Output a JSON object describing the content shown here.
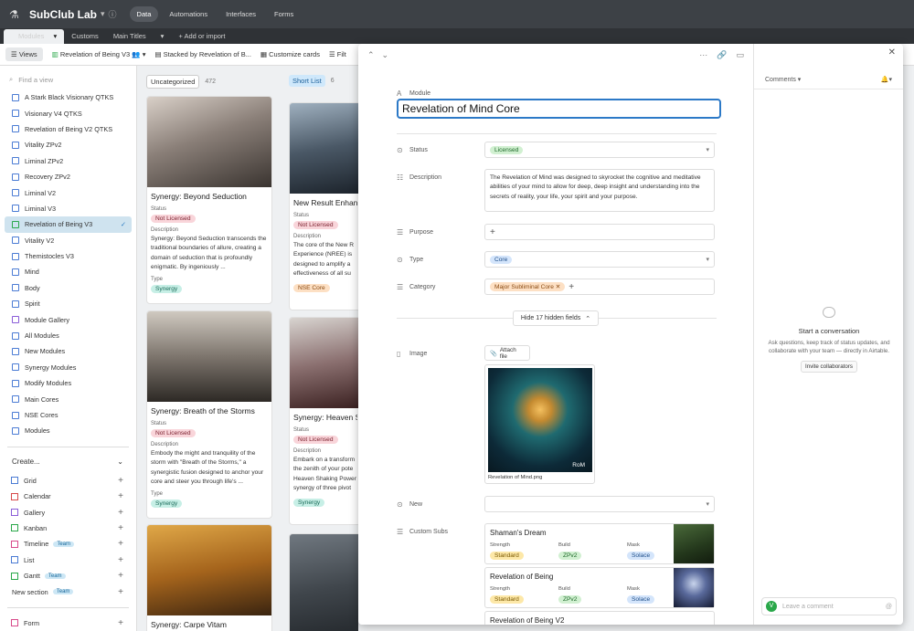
{
  "app": {
    "base_name": "SubClub Lab",
    "nav": [
      "Data",
      "Automations",
      "Interfaces",
      "Forms"
    ]
  },
  "tables": [
    "Modules",
    "Customs",
    "Main Titles",
    "+ Add or import"
  ],
  "toolbar": {
    "views": "Views",
    "current_view": "Revelation of Being V3",
    "stacked": "Stacked by Revelation of B...",
    "customize": "Customize cards",
    "filter": "Filt"
  },
  "sidebar": {
    "search_placeholder": "Find a view",
    "views": [
      {
        "label": "A Stark Black Visionary QTKS",
        "kind": "grid"
      },
      {
        "label": "Visionary V4 QTKS",
        "kind": "grid"
      },
      {
        "label": "Revelation of Being V2 QTKS",
        "kind": "grid"
      },
      {
        "label": "Vitality ZPv2",
        "kind": "grid"
      },
      {
        "label": "Liminal ZPv2",
        "kind": "grid"
      },
      {
        "label": "Recovery ZPv2",
        "kind": "grid"
      },
      {
        "label": "Liminal V2",
        "kind": "grid"
      },
      {
        "label": "Liminal V3",
        "kind": "grid"
      },
      {
        "label": "Revelation of Being V3",
        "kind": "kanban"
      },
      {
        "label": "Vitality V2",
        "kind": "grid"
      },
      {
        "label": "Themistocles V3",
        "kind": "grid"
      },
      {
        "label": "Mind",
        "kind": "grid"
      },
      {
        "label": "Body",
        "kind": "grid"
      },
      {
        "label": "Spirit",
        "kind": "grid"
      },
      {
        "label": "Module Gallery",
        "kind": "gallery"
      },
      {
        "label": "All Modules",
        "kind": "grid"
      },
      {
        "label": "New Modules",
        "kind": "grid"
      },
      {
        "label": "Synergy Modules",
        "kind": "grid"
      },
      {
        "label": "Modify Modules",
        "kind": "grid"
      },
      {
        "label": "Main Cores",
        "kind": "grid"
      },
      {
        "label": "NSE Cores",
        "kind": "grid"
      },
      {
        "label": "Modules",
        "kind": "grid"
      }
    ],
    "create_label": "Create...",
    "create_items": [
      {
        "label": "Grid",
        "badge": ""
      },
      {
        "label": "Calendar",
        "badge": ""
      },
      {
        "label": "Gallery",
        "badge": ""
      },
      {
        "label": "Kanban",
        "badge": ""
      },
      {
        "label": "Timeline",
        "badge": "Team"
      },
      {
        "label": "List",
        "badge": ""
      },
      {
        "label": "Gantt",
        "badge": "Team"
      }
    ],
    "new_section": "New section",
    "new_section_badge": "Team",
    "form_label": "Form"
  },
  "board": {
    "columns": [
      {
        "name": "Uncategorized",
        "count": "472"
      },
      {
        "name": "Short List",
        "count": "6"
      }
    ],
    "cards": [
      {
        "title": "Synergy: Beyond Seduction",
        "status_label": "Status",
        "status": "Not Licensed",
        "desc_label": "Description",
        "description": "Synergy: Beyond Seduction transcends the traditional boundaries of allure, creating a domain of seduction that is profoundly enigmatic. By ingeniously ...",
        "type_label": "Type",
        "type": "Synergy"
      },
      {
        "title": "Synergy: Breath of the Storms",
        "status_label": "Status",
        "status": "Not Licensed",
        "desc_label": "Description",
        "description": "Embody the might and tranquility of the storm with \"Breath of the Storms,\" a synergistic fusion designed to anchor your core and steer you through life's ...",
        "type_label": "Type",
        "type": "Synergy"
      },
      {
        "title": "Synergy: Carpe Vitam"
      },
      {
        "title": "New Result Enhanc",
        "status_label": "Status",
        "status": "Not Licensed",
        "desc_label": "Description",
        "description": "The core of the New R Experience (NREE) is designed to amplify a effectiveness of all su",
        "type_label": "Type",
        "type": "NSE Core"
      },
      {
        "title": "Synergy: Heaven S",
        "status_label": "Status",
        "status": "Not Licensed",
        "desc_label": "Description",
        "description": "Embark on a transform the zenith of your pote Heaven Shaking Power synergy of three pivot",
        "type_label": "Type",
        "type": "Synergy"
      }
    ]
  },
  "record": {
    "module_label": "Module",
    "module_value": "Revelation of Mind Core",
    "status_label": "Status",
    "status_value": "Licensed",
    "description_label": "Description",
    "description_value": "The Revelation of Mind was designed to skyrocket the cognitive and meditative abilities of your mind to allow for deep, deep insight and understanding into the secrets of reality, your life, your spirit and your purpose.",
    "purpose_label": "Purpose",
    "type_label": "Type",
    "type_value": "Core",
    "category_label": "Category",
    "category_value": "Major Subliminal Core",
    "hide_fields": "Hide 17 hidden fields",
    "image_label": "Image",
    "attach": "Attach file",
    "image_caption": "Revelation of Mind.png",
    "image_overlay": "RoM",
    "new_label": "New",
    "custom_subs_label": "Custom Subs",
    "subs": [
      {
        "title": "Shaman's Dream",
        "strength_label": "Strength",
        "strength": "Standard",
        "build_label": "Build",
        "build": "ZPv2",
        "mask_label": "Mask",
        "mask": "Solace"
      },
      {
        "title": "Revelation of Being",
        "strength_label": "Strength",
        "strength": "Standard",
        "build_label": "Build",
        "build": "ZPv2",
        "mask_label": "Mask",
        "mask": "Solace"
      },
      {
        "title": "Revelation of Being V2"
      }
    ]
  },
  "comments": {
    "header": "Comments",
    "empty_title": "Start a conversation",
    "empty_text": "Ask questions, keep track of status updates, and collaborate with your team — directly in Airtable.",
    "invite": "Invite collaborators",
    "avatar_letter": "V",
    "placeholder": "Leave a comment"
  }
}
